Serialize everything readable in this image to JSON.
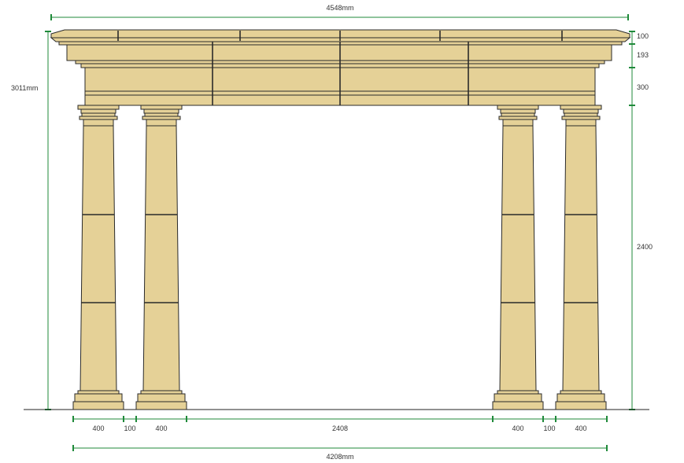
{
  "colors": {
    "stone": "#e5d197",
    "outline": "#2a2a2a",
    "dimension": "#1f8a3a",
    "text": "#333333"
  },
  "dimensions": {
    "overall_width": "4548mm",
    "overall_height": "3011mm",
    "cornice_height": "100",
    "architrave_height": "193",
    "frieze_height": "300",
    "column_height": "2400",
    "base_widths": [
      "400",
      "100",
      "400",
      "2408",
      "400",
      "100",
      "400"
    ],
    "base_total": "4208mm"
  }
}
